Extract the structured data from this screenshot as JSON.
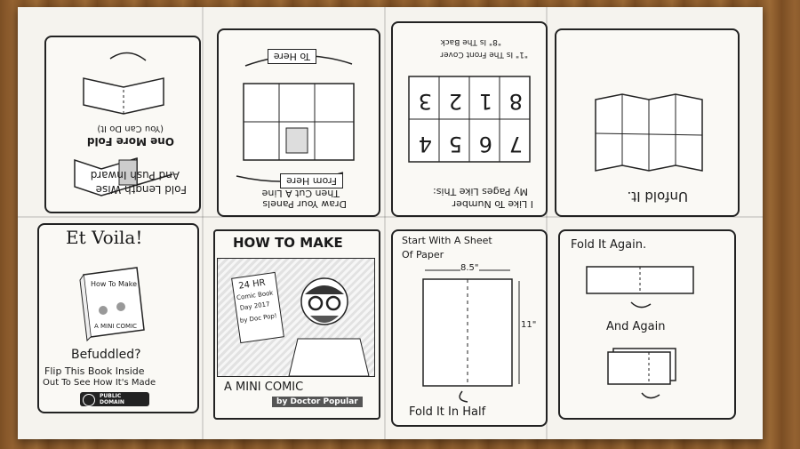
{
  "top_row": {
    "p1": {
      "line1": "Fold Length Wise",
      "line2": "And Push Inward",
      "line3": "One More Fold",
      "line4": "(You Can Do It)"
    },
    "p2": {
      "to_here": "To Here",
      "from_here": "From Here",
      "line1": "Draw Your Panels",
      "line2": "Then Cut A Line"
    },
    "p3": {
      "note1": "\"1\" Is The Front Cover",
      "note2": "\"8\" Is The Back",
      "numbers_top": [
        "8",
        "1",
        "2",
        "3"
      ],
      "numbers_bottom": [
        "7",
        "6",
        "5",
        "4"
      ],
      "line1": "I Like To Number",
      "line2": "My Pages Like This:"
    },
    "p4": {
      "caption": "Unfold It."
    }
  },
  "bottom_row": {
    "p5": {
      "title": "Et Voila!",
      "book_line1": "How To Make",
      "book_line2": "A MINI COMIC",
      "befuddled": "Befuddled?",
      "line1": "Flip This Book Inside",
      "line2": "Out To See How It's Made",
      "badge_line1": "PUBLIC",
      "badge_line2": "DOMAIN"
    },
    "p6": {
      "title": "HOW TO MAKE",
      "sign_line1": "24 HR",
      "sign_line2": "Comic Book",
      "sign_line3": "Day 2017",
      "sign_line4": "by Doc Pop!",
      "subtitle": "A MINI COMIC",
      "byline": "by Doctor Popular"
    },
    "p7": {
      "line1": "Start With A Sheet",
      "line2": "Of Paper",
      "width_label": "8.5\"",
      "height_label": "11\"",
      "caption": "Fold It In Half"
    },
    "p8": {
      "line1": "Fold It Again.",
      "line2": "And Again"
    }
  }
}
